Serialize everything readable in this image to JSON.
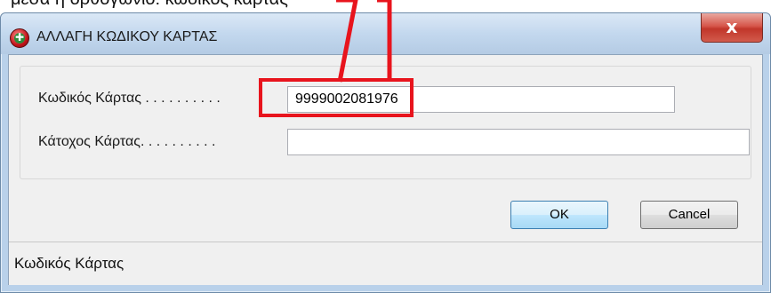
{
  "caption": "μέσα ή ορθογώνιο: κωδικός κάρτας",
  "window": {
    "title": "ΑΛΛΑΓΗ ΚΩΔΙΚΟΥ ΚΑΡΤΑΣ",
    "close_label": "x"
  },
  "form": {
    "card_code_label": "Κωδικός Κάρτας . . . . . . . . . .",
    "card_code_value": "9999002081976",
    "holder_label": "Κάτοχος  Κάρτας. . . . . . . . . .",
    "holder_value": ""
  },
  "buttons": {
    "ok_label": "OK",
    "cancel_label": "Cancel"
  },
  "status": {
    "text": "Κωδικός Κάρτας"
  },
  "colors": {
    "callout": "#e8141d"
  }
}
